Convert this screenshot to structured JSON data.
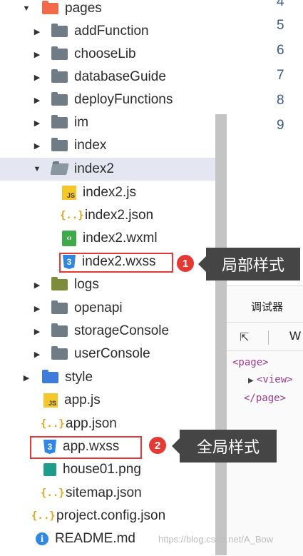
{
  "tree": {
    "pages": "pages",
    "addFunction": "addFunction",
    "chooseLib": "chooseLib",
    "databaseGuide": "databaseGuide",
    "deployFunctions": "deployFunctions",
    "im": "im",
    "index": "index",
    "index2": "index2",
    "index2_js": "index2.js",
    "index2_json": "index2.json",
    "index2_wxml": "index2.wxml",
    "index2_wxss": "index2.wxss",
    "logs": "logs",
    "openapi": "openapi",
    "storageConsole": "storageConsole",
    "userConsole": "userConsole",
    "style": "style",
    "app_js": "app.js",
    "app_json": "app.json",
    "app_wxss": "app.wxss",
    "house01": "house01.png",
    "sitemap": "sitemap.json",
    "project_config": "project.config.json",
    "readme": "README.md"
  },
  "icons": {
    "js_label": "JS",
    "json_label": "{..}",
    "info_label": "i"
  },
  "editor": {
    "line_numbers": [
      "4",
      "5",
      "6",
      "7",
      "8",
      "9"
    ]
  },
  "debugger": {
    "tab": "调试器",
    "toolbar_w": "W",
    "xml_open": "<page>",
    "xml_view": "<view>",
    "xml_close": "</page>"
  },
  "annotations": {
    "badge1": "1",
    "badge2": "2",
    "callout1": "局部样式",
    "callout2": "全局样式"
  },
  "watermark": "https://blog.csdn.net/A_Bow",
  "colors": {
    "highlight_red": "#e53935",
    "callout_bg": "#454545",
    "selected_row": "#e4e6f1"
  }
}
